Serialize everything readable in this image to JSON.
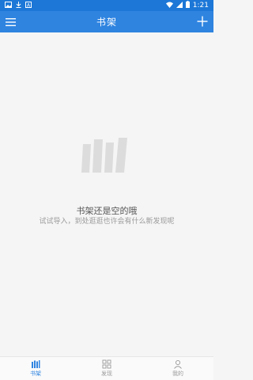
{
  "status_bar": {
    "time": "1:21",
    "icons": [
      "gallery-icon",
      "download-icon",
      "notification-icon",
      "wifi-icon",
      "signal-icon",
      "battery-icon"
    ]
  },
  "app_bar": {
    "title": "书架",
    "menu_icon": "hamburger-menu-icon",
    "add_icon": "plus-icon",
    "color": "#2f84e0"
  },
  "empty_state": {
    "icon": "bookshelf-books-icon",
    "title": "书架还是空的哦",
    "subtitle": "试试导入，到处逛逛也许会有什么新发现呢"
  },
  "bottom_nav": {
    "items": [
      {
        "label": "书架",
        "icon": "bookshelf-icon",
        "active": true
      },
      {
        "label": "发现",
        "icon": "grid-icon",
        "active": false
      },
      {
        "label": "我的",
        "icon": "person-icon",
        "active": false
      }
    ],
    "active_color": "#2f84e0",
    "inactive_color": "#999999"
  }
}
